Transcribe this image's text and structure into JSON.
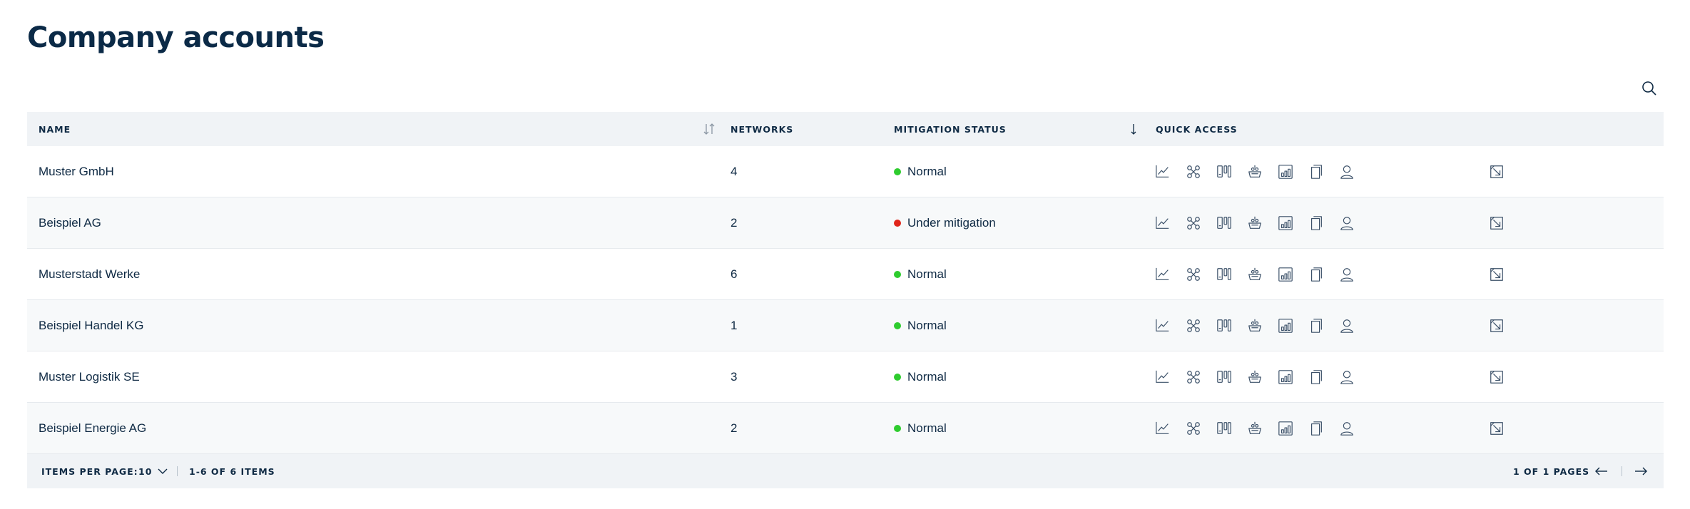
{
  "page": {
    "title": "Company accounts"
  },
  "table": {
    "columns": {
      "name": "NAME",
      "networks": "NETWORKS",
      "mitigation_status": "MITIGATION STATUS",
      "quick_access": "QUICK ACCESS"
    },
    "rows": [
      {
        "name": "Muster GmbH",
        "networks": "4",
        "status": "Normal",
        "status_color": "#2ecc2e"
      },
      {
        "name": "Beispiel AG",
        "networks": "2",
        "status": "Under mitigation",
        "status_color": "#e0261b"
      },
      {
        "name": "Musterstadt Werke",
        "networks": "6",
        "status": "Normal",
        "status_color": "#2ecc2e"
      },
      {
        "name": "Beispiel Handel KG",
        "networks": "1",
        "status": "Normal",
        "status_color": "#2ecc2e"
      },
      {
        "name": "Muster Logistik SE",
        "networks": "3",
        "status": "Normal",
        "status_color": "#2ecc2e"
      },
      {
        "name": "Beispiel Energie AG",
        "networks": "2",
        "status": "Normal",
        "status_color": "#2ecc2e"
      }
    ],
    "quick_access_icons": [
      "chart-line-icon",
      "network-icon",
      "devices-icon",
      "mitigation-icon",
      "report-icon",
      "document-icon",
      "user-icon"
    ],
    "row_action_icon": "open-external-icon"
  },
  "pagination": {
    "items_per_page_label": "ITEMS PER PAGE:",
    "items_per_page_value": "10",
    "range_text": "1-6 OF 6 ITEMS",
    "pages_text": "1 OF 1 PAGES"
  },
  "colors": {
    "title": "#0b2a47",
    "header_bg": "#f0f3f6",
    "alt_row_bg": "#f7f9fa",
    "status_normal": "#2ecc2e",
    "status_mitigation": "#e0261b"
  }
}
